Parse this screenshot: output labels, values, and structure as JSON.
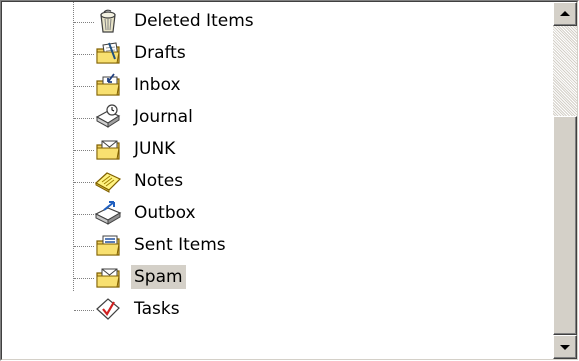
{
  "folders": [
    {
      "label": "Deleted Items",
      "icon": "trash-can-icon"
    },
    {
      "label": "Drafts",
      "icon": "drafts-folder-icon"
    },
    {
      "label": "Inbox",
      "icon": "inbox-icon"
    },
    {
      "label": "Journal",
      "icon": "journal-icon"
    },
    {
      "label": "JUNK",
      "icon": "mail-folder-icon"
    },
    {
      "label": "Notes",
      "icon": "notes-icon"
    },
    {
      "label": "Outbox",
      "icon": "outbox-icon"
    },
    {
      "label": "Sent Items",
      "icon": "sent-items-icon"
    },
    {
      "label": "Spam",
      "icon": "mail-folder-icon",
      "selected": true
    },
    {
      "label": "Tasks",
      "icon": "tasks-icon"
    }
  ],
  "scrollbar": {
    "up_icon": "scroll-up-arrow-icon",
    "down_icon": "scroll-down-arrow-icon"
  },
  "colors": {
    "selection": "#d4d0c8",
    "window": "#ffffff",
    "chrome": "#d4d0c8"
  }
}
